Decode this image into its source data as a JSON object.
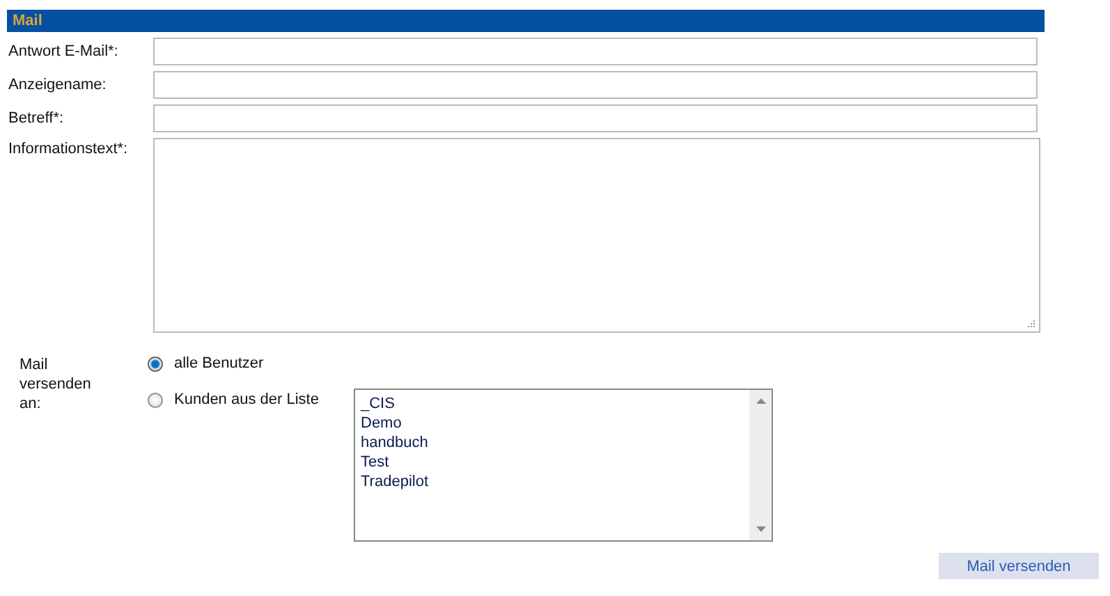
{
  "section": {
    "title": "Mail"
  },
  "fields": [
    {
      "kind": "text",
      "label": "Antwort E-Mail*:"
    },
    {
      "kind": "text",
      "label": "Anzeigename:"
    },
    {
      "kind": "text",
      "label": "Betreff*:"
    },
    {
      "kind": "textarea",
      "label": "Informationstext*:"
    }
  ],
  "recipients": {
    "label": "Mail versenden an:",
    "options": [
      {
        "label": "alle Benutzer",
        "selected": true
      },
      {
        "label": "Kunden aus der Liste",
        "selected": false
      }
    ],
    "list": [
      "_CIS",
      "Demo",
      "handbuch",
      "Test",
      "Tradepilot"
    ]
  },
  "submit": "Mail versenden"
}
